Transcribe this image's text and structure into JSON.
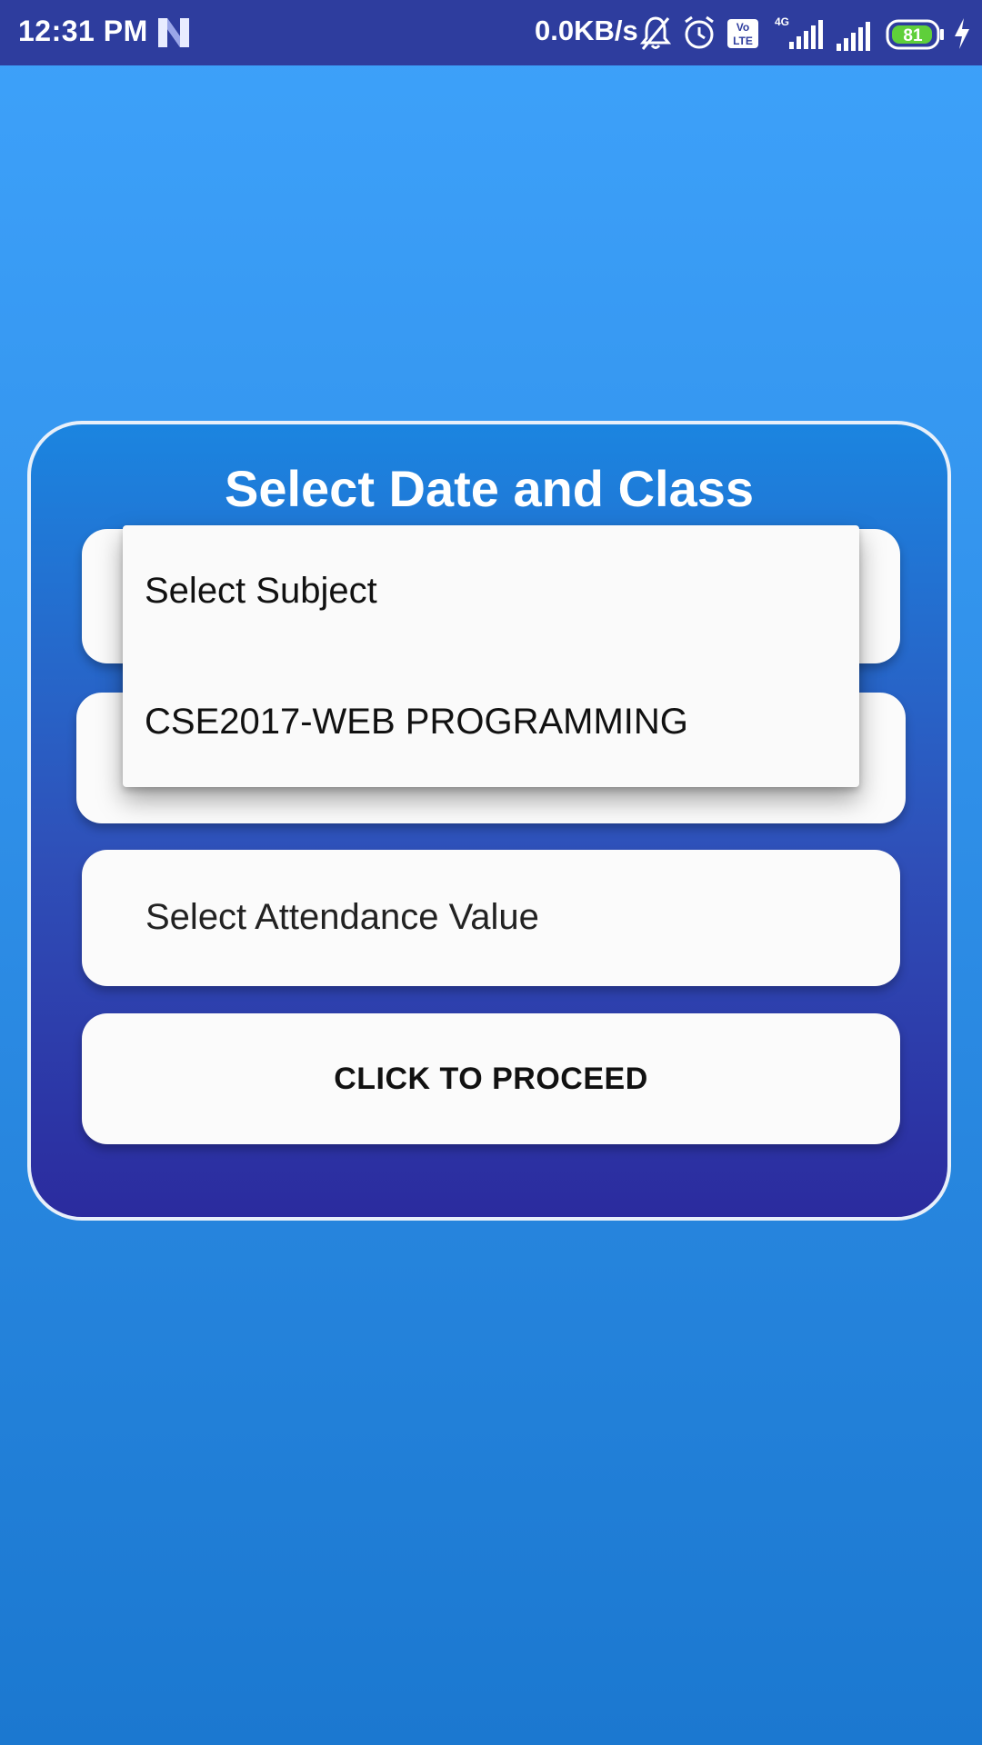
{
  "status_bar": {
    "time": "12:31 PM",
    "net_speed": "0.0KB/s",
    "network_type": "4G",
    "volte_label_top": "Vo",
    "volte_label_bottom": "LTE",
    "battery_level": "81",
    "icons": [
      "n-icon",
      "bell-muted-icon",
      "alarm-icon",
      "volte-icon",
      "signal-icon",
      "signal-icon",
      "battery-icon",
      "charging-icon"
    ],
    "battery_color": "#5fcf3a"
  },
  "card": {
    "title": "Select Date and Class"
  },
  "fields": {
    "attendance_placeholder": "Select Attendance Value",
    "proceed_label": "CLICK TO PROCEED"
  },
  "dropdown": {
    "items": [
      {
        "label": "Select Subject"
      },
      {
        "label": "CSE2017-WEB PROGRAMMING"
      }
    ]
  },
  "colors": {
    "status_bar": "#2e3d9e",
    "background_top": "#3ea2fb",
    "card_top": "#1b85e0",
    "card_bottom": "#2b2b9e"
  }
}
